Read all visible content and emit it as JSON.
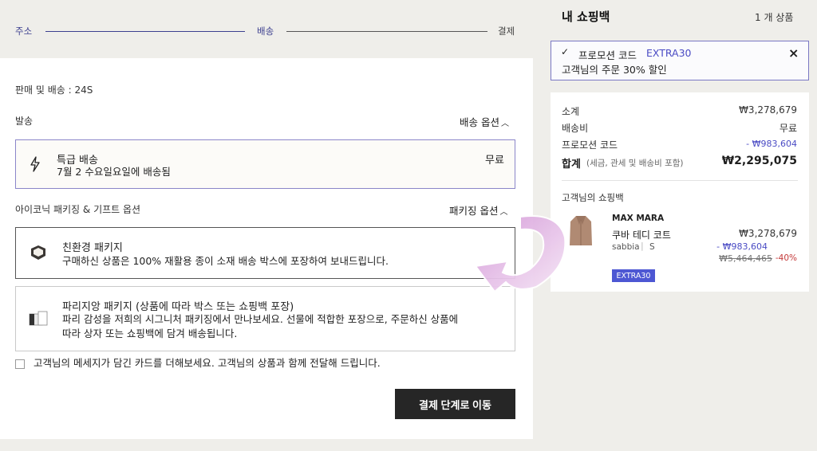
{
  "steps": {
    "address": "주소",
    "shipping": "배송",
    "payment": "결제"
  },
  "seller": "판매 및 배송 : 24S",
  "dispatch": {
    "label": "발송",
    "options_link": "배송 옵션"
  },
  "express": {
    "title": "특급 배송",
    "date": "7월 2 수요일요일에 배송됨",
    "price": "무료"
  },
  "packaging": {
    "label": "아이코닉 패키징 & 기프트 옵션",
    "options_link": "패키징 옵션",
    "eco": {
      "title": "친환경 패키지",
      "desc": "구매하신 상품은 100% 재활용 종이 소재 배송 박스에 포장하여 보내드립니다."
    },
    "parisian": {
      "title": "파리지앙 패키지 (상품에 따라 박스 또는 쇼핑백 포장)",
      "desc_line1": "파리 감성을 저희의 시그니처 패키징에서 만나보세요. 선물에 적합한 포장으로, 주문하신 상품에",
      "desc_line2": "따라 상자 또는 쇼핑백에 담겨 배송됩니다."
    }
  },
  "gift_card_text": "고객님의 메세지가 담긴 카드를 더해보세요. 고객님의 상품과 함께 전달해 드립니다.",
  "cta": "결제 단계로 이동",
  "bag": {
    "title": "내 쇼핑백",
    "count": "1 개 상품",
    "promo": {
      "label": "프로모션 코드",
      "code": "EXTRA30",
      "desc": "고객님의 주문 30% 할인"
    },
    "summary": {
      "subtotal_label": "소계",
      "subtotal": "₩3,278,679",
      "shipping_label": "배송비",
      "shipping": "무료",
      "promo_label": "프로모션 코드",
      "promo": "- ₩983,604",
      "total_label": "합계",
      "total_note": "(세금, 관세 및 배송비 포함)",
      "total": "₩2,295,075"
    },
    "items_title": "고객님의 쇼핑백",
    "item": {
      "brand": "MAX MARA",
      "name": "쿠바 테디 코트",
      "color": "sabbia",
      "size": "S",
      "price": "₩3,278,679",
      "discount": "- ₩983,604",
      "original": "₩5,464,465",
      "pct": "-40%",
      "badge": "EXTRA30"
    }
  },
  "colors": {
    "accent": "#3c3f8f",
    "promo_blue": "#4a4bc4",
    "discount_red": "#c43a3a",
    "badge_bg": "#4d57d3",
    "cta_bg": "#262626"
  }
}
